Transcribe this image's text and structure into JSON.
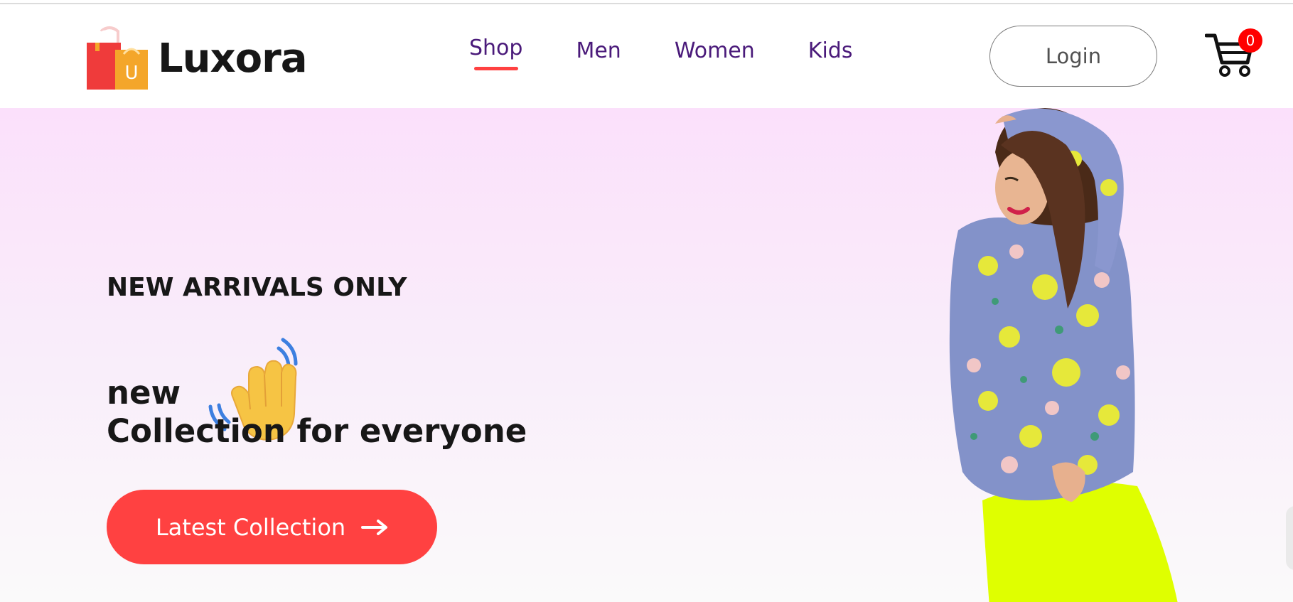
{
  "brand": {
    "name": "Luxora",
    "logo_icon": "shopping-bag-icon",
    "logo_letter": "U"
  },
  "nav": {
    "items": [
      {
        "label": "Shop",
        "active": true
      },
      {
        "label": "Men",
        "active": false
      },
      {
        "label": "Women",
        "active": false
      },
      {
        "label": "Kids",
        "active": false
      }
    ]
  },
  "header": {
    "login_label": "Login",
    "cart_icon": "cart-icon",
    "cart_count": "0"
  },
  "hero": {
    "subtitle": "NEW ARRIVALS ONLY",
    "line1": "new",
    "hand_icon": "waving-hand-icon",
    "line2": "Collection for everyone",
    "cta_label": "Latest Collection",
    "cta_icon": "arrow-right-icon",
    "image": "woman-floral-sweater-image"
  },
  "colors": {
    "accent": "#ff4141",
    "nav_text": "#4a1a7a",
    "hero_gradient_top": "#fbe0fb",
    "hero_gradient_bottom": "#fafafa",
    "cart_badge": "#ff0000"
  }
}
